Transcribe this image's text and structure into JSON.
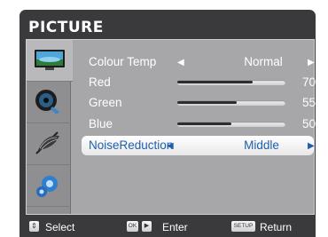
{
  "menu": {
    "title": "PICTURE"
  },
  "tabs": [
    {
      "name": "picture-tab",
      "icon": "monitor-icon"
    },
    {
      "name": "sound-tab",
      "icon": "speaker-disc-icon"
    },
    {
      "name": "setting-tab",
      "icon": "fan-icon"
    },
    {
      "name": "options-tab",
      "icon": "gears-icon"
    }
  ],
  "settings": {
    "colour_temp": {
      "label": "Colour Temp",
      "value": "Normal"
    },
    "red": {
      "label": "Red",
      "value": 70
    },
    "green": {
      "label": "Green",
      "value": 55
    },
    "blue": {
      "label": "Blue",
      "value": 50
    },
    "noise_reduction": {
      "label": "NoiseReduction",
      "value": "Middle"
    }
  },
  "footer": {
    "select": "Select",
    "ok_key": "OK",
    "enter": "Enter",
    "setup_key": "SETUP",
    "return": "Return"
  },
  "colors": {
    "highlight_text": "#1f5fae",
    "panel": "#a7a7a9",
    "frame": "#3a3a3d"
  }
}
